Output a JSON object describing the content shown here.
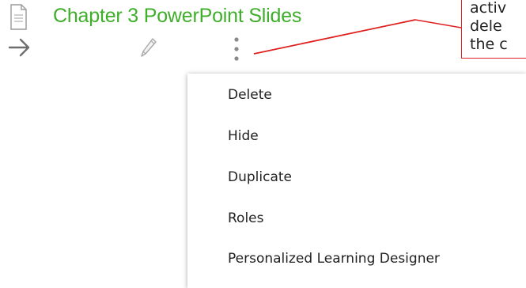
{
  "page": {
    "title": "Chapter 3 PowerPoint Slides",
    "title_color": "#3fae2a"
  },
  "icons": {
    "file": "file-document-icon",
    "navigate": "arrow-right-icon",
    "edit": "pencil-icon",
    "more": "more-options-icon"
  },
  "callout": {
    "lines": [
      "activ",
      "dele",
      "the c"
    ],
    "border_color": "#e02020"
  },
  "menu": {
    "items": [
      {
        "label": "Delete"
      },
      {
        "label": "Hide"
      },
      {
        "label": "Duplicate"
      },
      {
        "label": "Roles"
      },
      {
        "label": "Personalized Learning Designer"
      }
    ]
  }
}
